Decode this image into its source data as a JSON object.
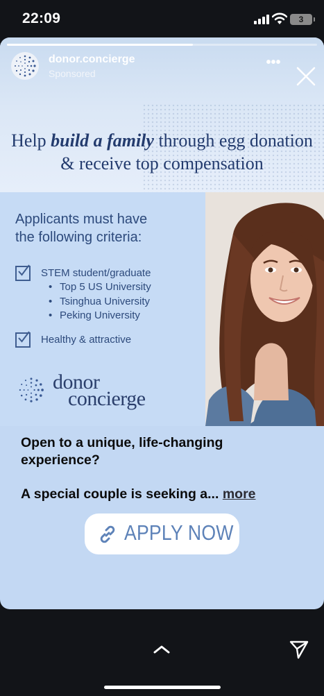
{
  "status_bar": {
    "time": "22:09",
    "battery_level": "3"
  },
  "story": {
    "progress": 0.6,
    "account": {
      "name": "donor.concierge",
      "sponsored_label": "Sponsored"
    },
    "ad": {
      "headline_prefix": "Help ",
      "headline_emphasis": "build a family",
      "headline_suffix": " through egg donation",
      "headline_line2": "& receive top compensation",
      "criteria_heading_line1": "Applicants must have",
      "criteria_heading_line2": "the following criteria:",
      "criteria": [
        {
          "label": "STEM student/graduate",
          "checked": true
        },
        {
          "label": "Healthy & attractive",
          "checked": true
        }
      ],
      "universities": [
        "Top 5 US University",
        "Tsinghua University",
        "Peking University"
      ],
      "brand_word1": "donor",
      "brand_word2": "concierge"
    },
    "caption_line1": "Open to a unique, life-changing experience?",
    "caption_line2": "A special couple is seeking a... ",
    "more_link": "more",
    "cta_label": "APPLY NOW"
  },
  "colors": {
    "ad_navy": "#233b6e",
    "panel_blue": "#c6dbf5",
    "cta_text": "#5d82b8",
    "app_background": "#121418"
  },
  "icons": [
    "signal-icon",
    "wifi-icon",
    "battery-icon",
    "more-options-icon",
    "close-icon",
    "check-icon",
    "link-icon",
    "chevron-up-icon",
    "send-icon"
  ]
}
